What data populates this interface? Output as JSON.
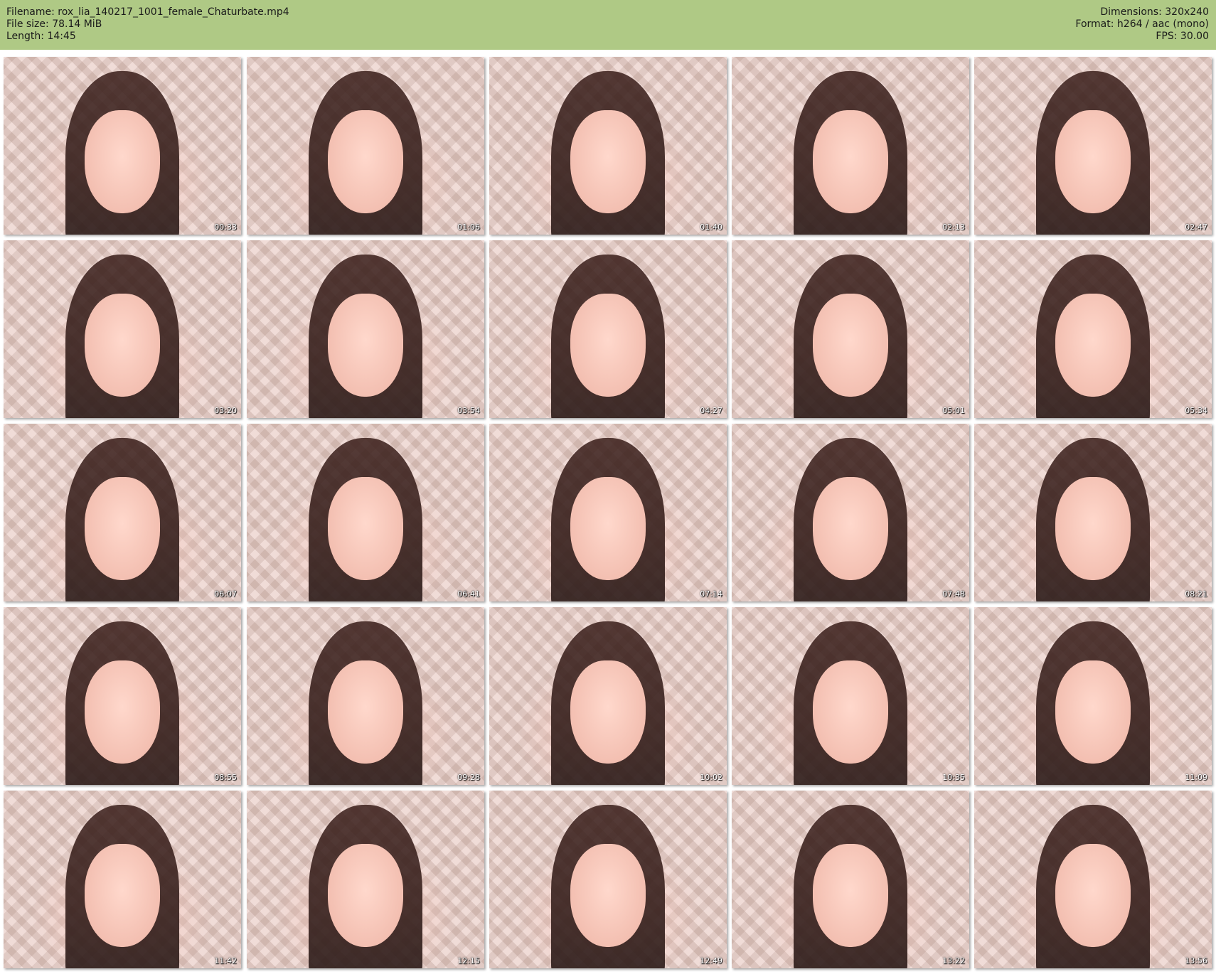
{
  "header": {
    "filename": "Filename: rox_lia_140217_1001_female_Chaturbate.mp4",
    "file_size": "File size: 78.14 MiB",
    "length": "Length: 14:45",
    "dimensions": "Dimensions: 320x240",
    "format": "Format: h264 / aac (mono)",
    "fps": "FPS: 30.00"
  },
  "thumbnails": [
    {
      "timestamp": "00:33"
    },
    {
      "timestamp": "01:06"
    },
    {
      "timestamp": "01:40"
    },
    {
      "timestamp": "02:13"
    },
    {
      "timestamp": "02:47"
    },
    {
      "timestamp": "03:20"
    },
    {
      "timestamp": "03:54"
    },
    {
      "timestamp": "04:27"
    },
    {
      "timestamp": "05:01"
    },
    {
      "timestamp": "05:34"
    },
    {
      "timestamp": "06:07"
    },
    {
      "timestamp": "06:41"
    },
    {
      "timestamp": "07:14"
    },
    {
      "timestamp": "07:48"
    },
    {
      "timestamp": "08:21"
    },
    {
      "timestamp": "08:55"
    },
    {
      "timestamp": "09:28"
    },
    {
      "timestamp": "10:02"
    },
    {
      "timestamp": "10:35"
    },
    {
      "timestamp": "11:09"
    },
    {
      "timestamp": "11:42"
    },
    {
      "timestamp": "12:15"
    },
    {
      "timestamp": "12:49"
    },
    {
      "timestamp": "13:22"
    },
    {
      "timestamp": "13:56"
    }
  ],
  "colors": {
    "header_bg": "#afc985",
    "page_bg": "#ffffff"
  }
}
